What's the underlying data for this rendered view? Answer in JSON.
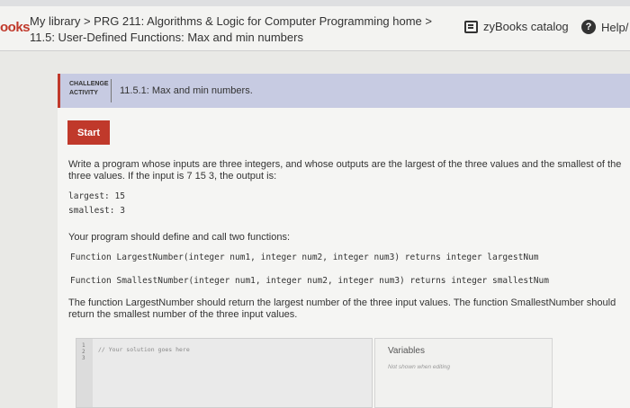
{
  "header": {
    "brand": "ooks",
    "breadcrumb_line1": "My library > PRG 211: Algorithms & Logic for Computer Programming home >",
    "breadcrumb_line2": "11.5: User-Defined Functions: Max and min numbers",
    "catalog_label": "zyBooks catalog",
    "help_label": "Help/"
  },
  "challenge": {
    "label_line1": "CHALLENGE",
    "label_line2": "ACTIVITY",
    "title": "11.5.1: Max and min numbers."
  },
  "content": {
    "start_button": "Start",
    "prompt_line1": "Write a program whose inputs are three integers, and whose outputs are the largest of the three values and the smallest of the",
    "prompt_line2": "three values. If the input is 7 15 3, the output is:",
    "output_line1": "largest: 15",
    "output_line2": "smallest: 3",
    "define_text": "Your program should define and call two functions:",
    "function1": "Function LargestNumber(integer num1, integer num2, integer num3) returns integer largestNum",
    "function2": "Function SmallestNumber(integer num1, integer num2, integer num3) returns integer smallestNum",
    "explain_line1": "The function LargestNumber should return the largest number of the three input values. The function SmallestNumber should",
    "explain_line2": "return the smallest number of the three input values."
  },
  "editor": {
    "line_numbers": [
      "1",
      "2",
      "3"
    ],
    "code_line": "// Your solution goes here"
  },
  "variables": {
    "title": "Variables",
    "note": "Not shown when editing"
  },
  "colors": {
    "accent": "#c0392b",
    "challenge_bar": "#c7cbe2"
  }
}
